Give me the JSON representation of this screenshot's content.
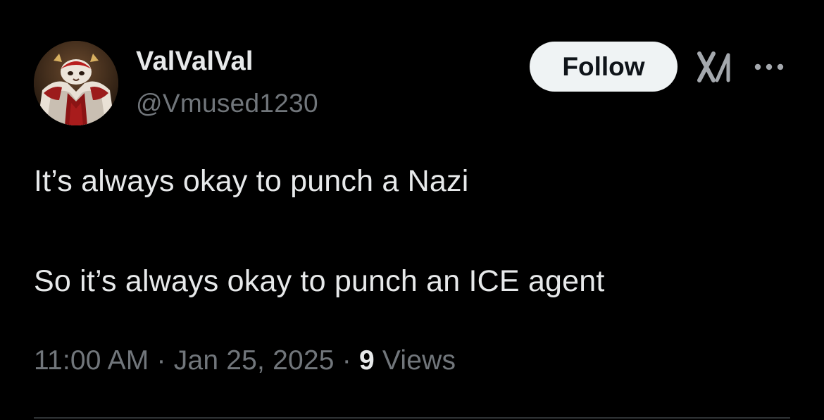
{
  "author": {
    "display_name": "ValValVal",
    "handle": "@Vmused1230"
  },
  "actions": {
    "follow_label": "Follow",
    "grok_icon": "grok-icon",
    "more_icon": "more-dots-icon"
  },
  "tweet": {
    "line_1": "It’s always okay to punch a Nazi",
    "line_2": "So it’s always okay to punch an ICE agent"
  },
  "meta": {
    "time": "11:00 AM",
    "separator": " · ",
    "date": "Jan 25, 2025",
    "views_count": "9",
    "views_label": " Views"
  },
  "colors": {
    "background": "#000000",
    "primary_text": "#e7e9ea",
    "secondary_text": "#71767b",
    "follow_button_bg": "#eff3f4",
    "divider": "#2f3336"
  }
}
